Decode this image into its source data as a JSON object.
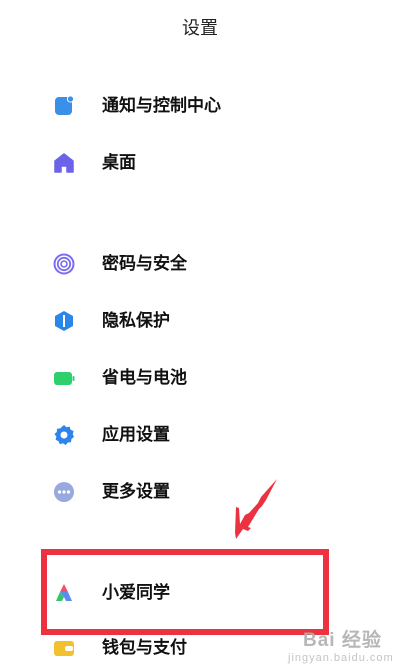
{
  "header": {
    "title": "设置"
  },
  "items": [
    {
      "label": "通知与控制中心",
      "icon": "notification-icon",
      "color": "#3a8fe8"
    },
    {
      "label": "桌面",
      "icon": "home-icon",
      "color": "#6c63e8"
    },
    {
      "label": "密码与安全",
      "icon": "fingerprint-icon",
      "color": "#7a6cf0"
    },
    {
      "label": "隐私保护",
      "icon": "privacy-icon",
      "color": "#2a86e8"
    },
    {
      "label": "省电与电池",
      "icon": "battery-icon",
      "color": "#2ed06e"
    },
    {
      "label": "应用设置",
      "icon": "gear-icon",
      "color": "#2f84ec"
    },
    {
      "label": "更多设置",
      "icon": "more-icon",
      "color": "#9aa8e0"
    },
    {
      "label": "小爱同学",
      "icon": "xiaoai-icon",
      "color": "#5c8cf0"
    },
    {
      "label": "钱包与支付",
      "icon": "wallet-icon",
      "color": "#f2c12e"
    }
  ],
  "annotation": {
    "highlight_color": "#ec3240",
    "highlighted_item": "小爱同学"
  },
  "watermark": {
    "text": "Bai 经验",
    "sub": "jingyan.baidu.com"
  }
}
